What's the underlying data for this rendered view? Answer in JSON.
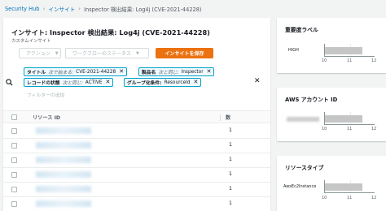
{
  "breadcrumb": {
    "items": [
      "Security Hub",
      "インサイト",
      "Inspector 検出結果: Log4j (CVE-2021-44228)"
    ],
    "separator": "›"
  },
  "insight": {
    "title": "インサイト: Inspector 検出結果: Log4j (CVE-2021-44228)",
    "subtitle": "カスタムインサイト"
  },
  "toolbar": {
    "actions_label": "アクション",
    "workflow_label": "ワークフローのステータス",
    "save_label": "インサイトを保存"
  },
  "filters": {
    "chips": [
      {
        "key": "タイトル",
        "op": "次で始まる:",
        "value": "CVE-2021-44228"
      },
      {
        "key": "製品名",
        "op": "次と同じ:",
        "value": "Inspector"
      },
      {
        "key": "レコードの状態",
        "op": "次と同じ:",
        "value": "ACTIVE"
      },
      {
        "key": "グループ化条件:",
        "op": "",
        "value": "ResourceId"
      }
    ],
    "add_placeholder": "フィルターの追加"
  },
  "table": {
    "columns": [
      "リソース ID",
      "数"
    ],
    "rows": [
      {
        "count": "1"
      },
      {
        "count": "1"
      },
      {
        "count": "1"
      },
      {
        "count": "1"
      },
      {
        "count": "1"
      },
      {
        "count": "1"
      }
    ]
  },
  "sidebar": {
    "severity": {
      "title": "重要度ラベル",
      "label": "HIGH",
      "ticks": [
        "10",
        "11",
        "12"
      ],
      "value": 11.5
    },
    "account": {
      "title": "AWS アカウント ID",
      "ticks": [
        "10",
        "11",
        "12"
      ],
      "value": 11.5
    },
    "resource_type": {
      "title": "リソースタイプ",
      "label": "AwsEc2Instance",
      "ticks": [
        "10",
        "11",
        "12"
      ],
      "value": 11.5
    }
  },
  "colors": {
    "link": "#0073bb",
    "primary_button": "#ec7211",
    "chip_border": "#00a1c9",
    "bar": "#c6c6c6"
  }
}
